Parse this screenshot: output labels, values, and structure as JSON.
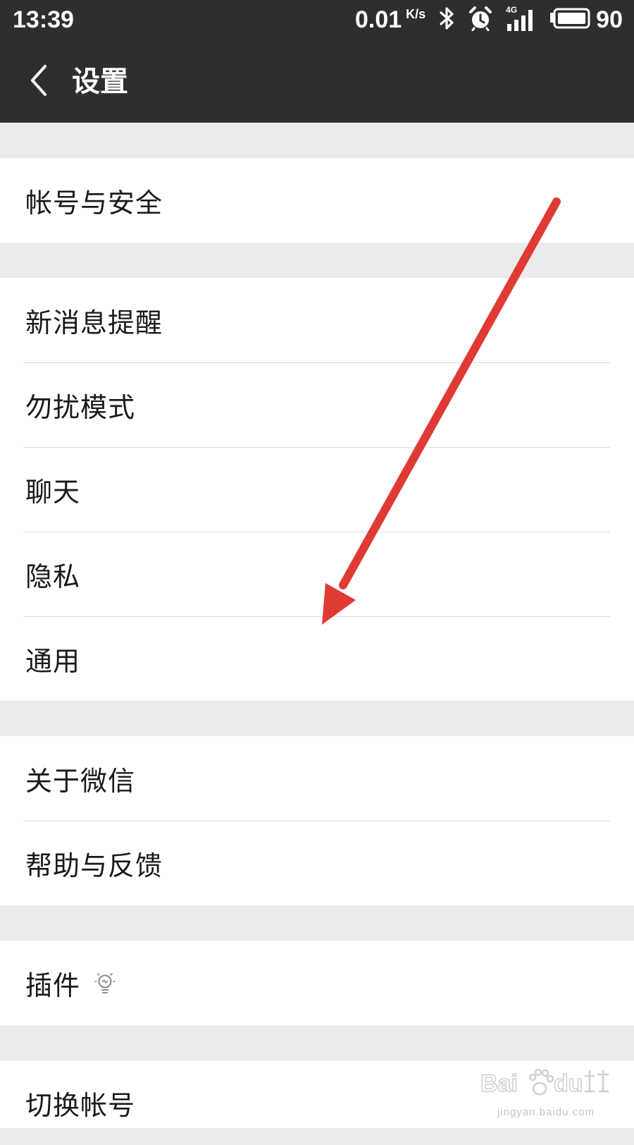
{
  "status_bar": {
    "time": "13:39",
    "net_speed": "0.01",
    "net_speed_unit": "K/s",
    "signal_type": "4G",
    "battery_percent": "90",
    "icons": [
      "bluetooth-icon",
      "alarm-icon",
      "signal-icon",
      "battery-icon"
    ]
  },
  "header": {
    "title": "设置"
  },
  "groups": [
    {
      "items": [
        {
          "label": "帐号与安全"
        }
      ]
    },
    {
      "items": [
        {
          "label": "新消息提醒"
        },
        {
          "label": "勿扰模式"
        },
        {
          "label": "聊天"
        },
        {
          "label": "隐私"
        },
        {
          "label": "通用"
        }
      ]
    },
    {
      "items": [
        {
          "label": "关于微信"
        },
        {
          "label": "帮助与反馈"
        }
      ]
    },
    {
      "items": [
        {
          "label": "插件",
          "icon": "lightbulb-icon"
        }
      ]
    },
    {
      "items": [
        {
          "label": "切换帐号"
        }
      ]
    }
  ],
  "watermark": {
    "text": "jingyan.baidu.com"
  },
  "colors": {
    "header_bg": "#2e2e2e",
    "page_bg": "#ebebeb",
    "arrow": "#e03a34"
  }
}
